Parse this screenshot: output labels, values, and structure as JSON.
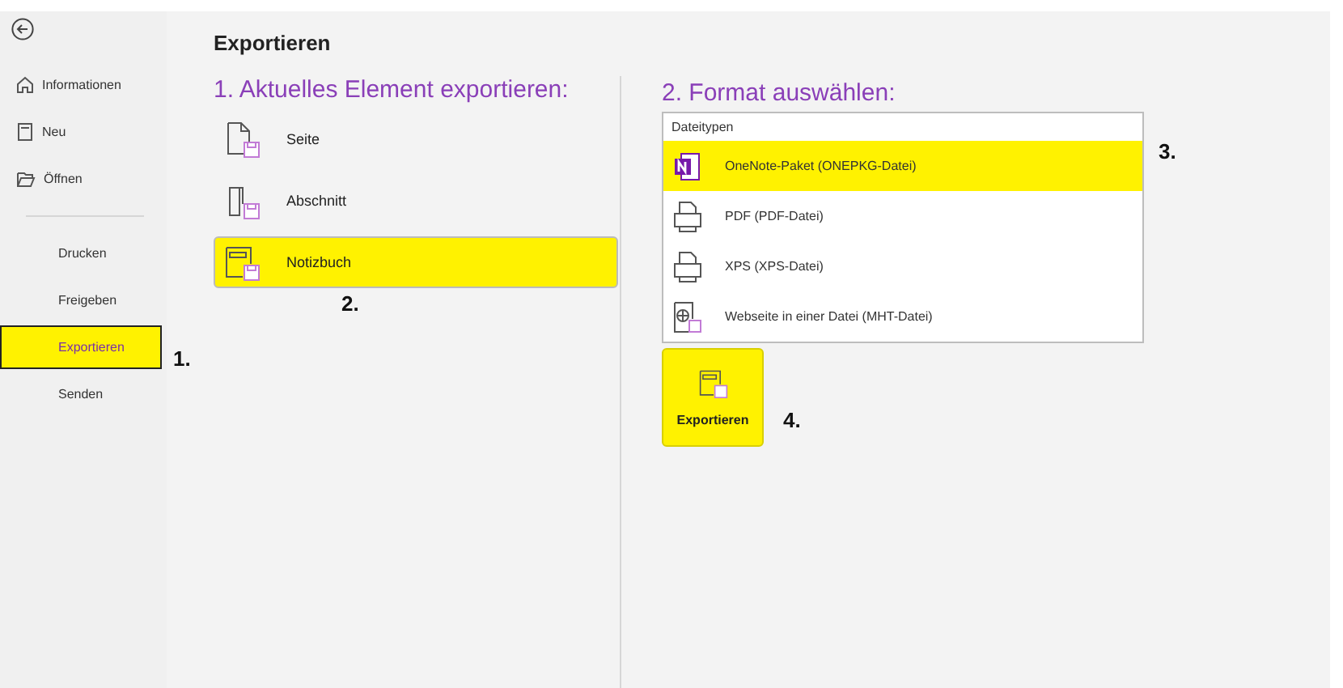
{
  "sidebar": {
    "items": [
      {
        "kind": "home",
        "label": "Informationen",
        "selected": false
      },
      {
        "kind": "notebook",
        "label": "Neu",
        "selected": false
      },
      {
        "kind": "folder",
        "label": "Öffnen",
        "selected": false
      },
      {
        "kind": "plain",
        "label": "Drucken",
        "selected": false
      },
      {
        "kind": "plain",
        "label": "Freigeben",
        "selected": false
      },
      {
        "kind": "plain",
        "label": "Exportieren",
        "selected": true,
        "callout": "1."
      },
      {
        "kind": "plain",
        "label": "Senden",
        "selected": false
      }
    ]
  },
  "title": "Exportieren",
  "export_scope": {
    "heading": "1. Aktuelles Element exportieren:",
    "items": [
      {
        "kind": "page",
        "label": "Seite",
        "selected": false
      },
      {
        "kind": "section",
        "label": "Abschnitt",
        "selected": false
      },
      {
        "kind": "notebook",
        "label": "Notizbuch",
        "selected": true,
        "callout": "2."
      }
    ]
  },
  "format": {
    "heading": "2. Format auswählen:",
    "list_header": "Dateitypen",
    "callout": "3.",
    "items": [
      {
        "kind": "onenote",
        "label": "OneNote-Paket (ONEPKG-Datei)",
        "selected": true
      },
      {
        "kind": "printer",
        "label": "PDF (PDF-Datei)",
        "selected": false
      },
      {
        "kind": "printer",
        "label": "XPS (XPS-Datei)",
        "selected": false
      },
      {
        "kind": "web",
        "label": "Webseite in einer Datei (MHT-Datei)",
        "selected": false
      }
    ]
  },
  "export_button": {
    "label": "Exportieren",
    "callout": "4."
  }
}
